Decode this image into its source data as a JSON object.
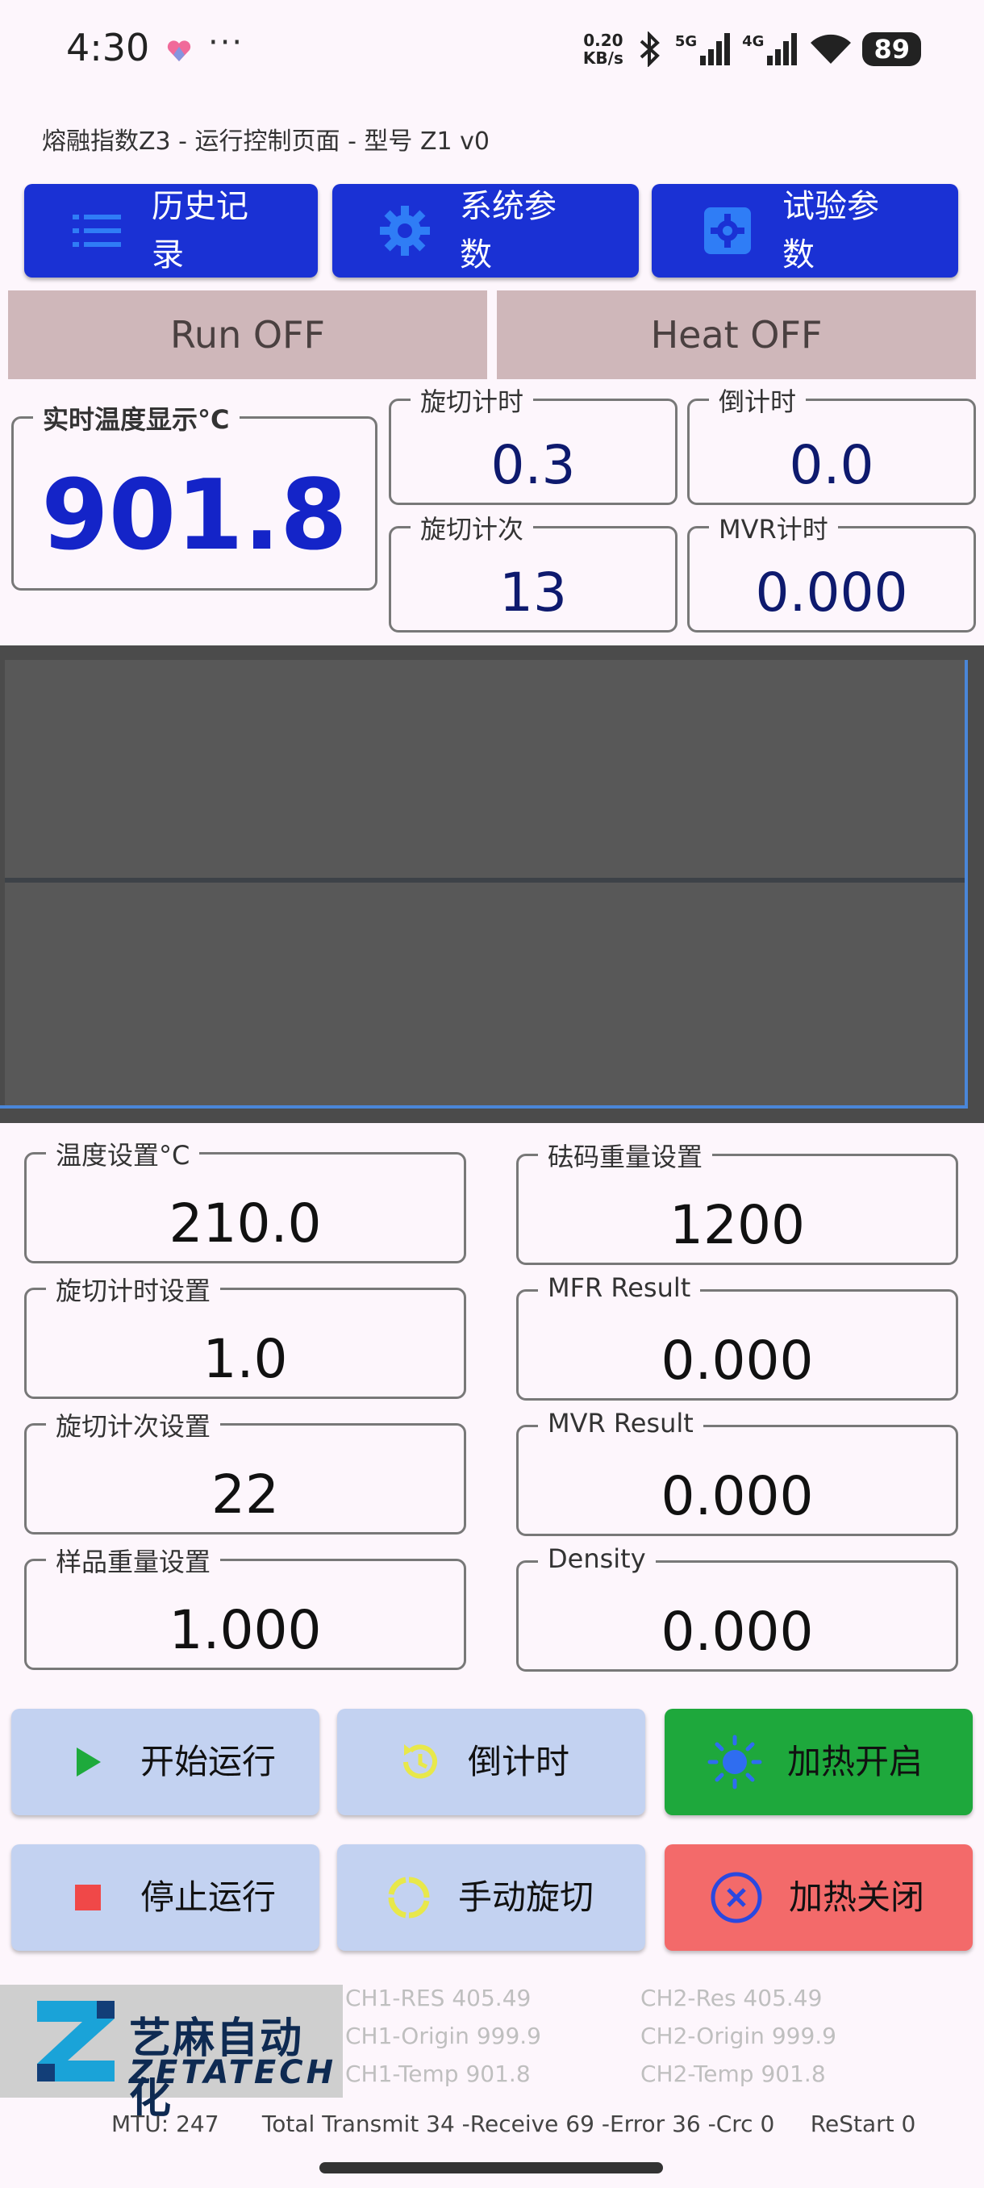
{
  "status_bar": {
    "time": "4:30",
    "dots": "···",
    "net_speed_value": "0.20",
    "net_speed_unit": "KB/s",
    "battery": "89",
    "signal_5g": "5G",
    "signal_4g": "4G"
  },
  "app_title": "熔融指数Z3 - 运行控制页面 - 型号 Z1 v0",
  "top_buttons": {
    "history": "历史记录",
    "system_params": "系统参数",
    "test_params": "试验参数"
  },
  "toggles": {
    "run": "Run OFF",
    "heat": "Heat OFF"
  },
  "readouts": {
    "temp_label": "实时温度显示°C",
    "temp_value": "901.8",
    "cut_timer_label": "旋切计时",
    "cut_timer_value": "0.3",
    "countdown_label": "倒计时",
    "countdown_value": "0.0",
    "cut_count_label": "旋切计次",
    "cut_count_value": "13",
    "mvr_timer_label": "MVR计时",
    "mvr_timer_value": "0.000"
  },
  "settings": {
    "temp_set_label": "温度设置°C",
    "temp_set_value": "210.0",
    "weight_set_label": "砝码重量设置",
    "weight_set_value": "1200",
    "cut_time_set_label": "旋切计时设置",
    "cut_time_set_value": "1.0",
    "mfr_label": "MFR Result",
    "mfr_value": "0.000",
    "cut_count_set_label": "旋切计次设置",
    "cut_count_set_value": "22",
    "mvr_label": "MVR Result",
    "mvr_value": "0.000",
    "sample_weight_label": "样品重量设置",
    "sample_weight_value": "1.000",
    "density_label": "Density",
    "density_value": "0.000"
  },
  "actions": {
    "start_run": "开始运行",
    "countdown": "倒计时",
    "heat_on": "加热开启",
    "stop_run": "停止运行",
    "manual_cut": "手动旋切",
    "heat_off": "加热关闭"
  },
  "colors": {
    "primary_blue": "#1a31d4",
    "action_light": "#c3d2f1",
    "heat_on_green": "#1ea83c",
    "heat_off_red": "#f36a6a",
    "toggle_bg": "#cfb7ba"
  },
  "footer": {
    "logo_cn": "艺麻自动化",
    "logo_en": "ZETATECH",
    "ch1_res": "CH1-RES  405.49",
    "ch1_origin": "CH1-Origin  999.9",
    "ch1_temp": "CH1-Temp  901.8",
    "ch2_res": "CH2-Res  405.49",
    "ch2_origin": "CH2-Origin  999.9",
    "ch2_temp": "CH2-Temp  901.8",
    "stats_line": "MTU: 247      Total Transmit 34 -Receive 69 -Error 36 -Crc 0     ReStart 0"
  }
}
